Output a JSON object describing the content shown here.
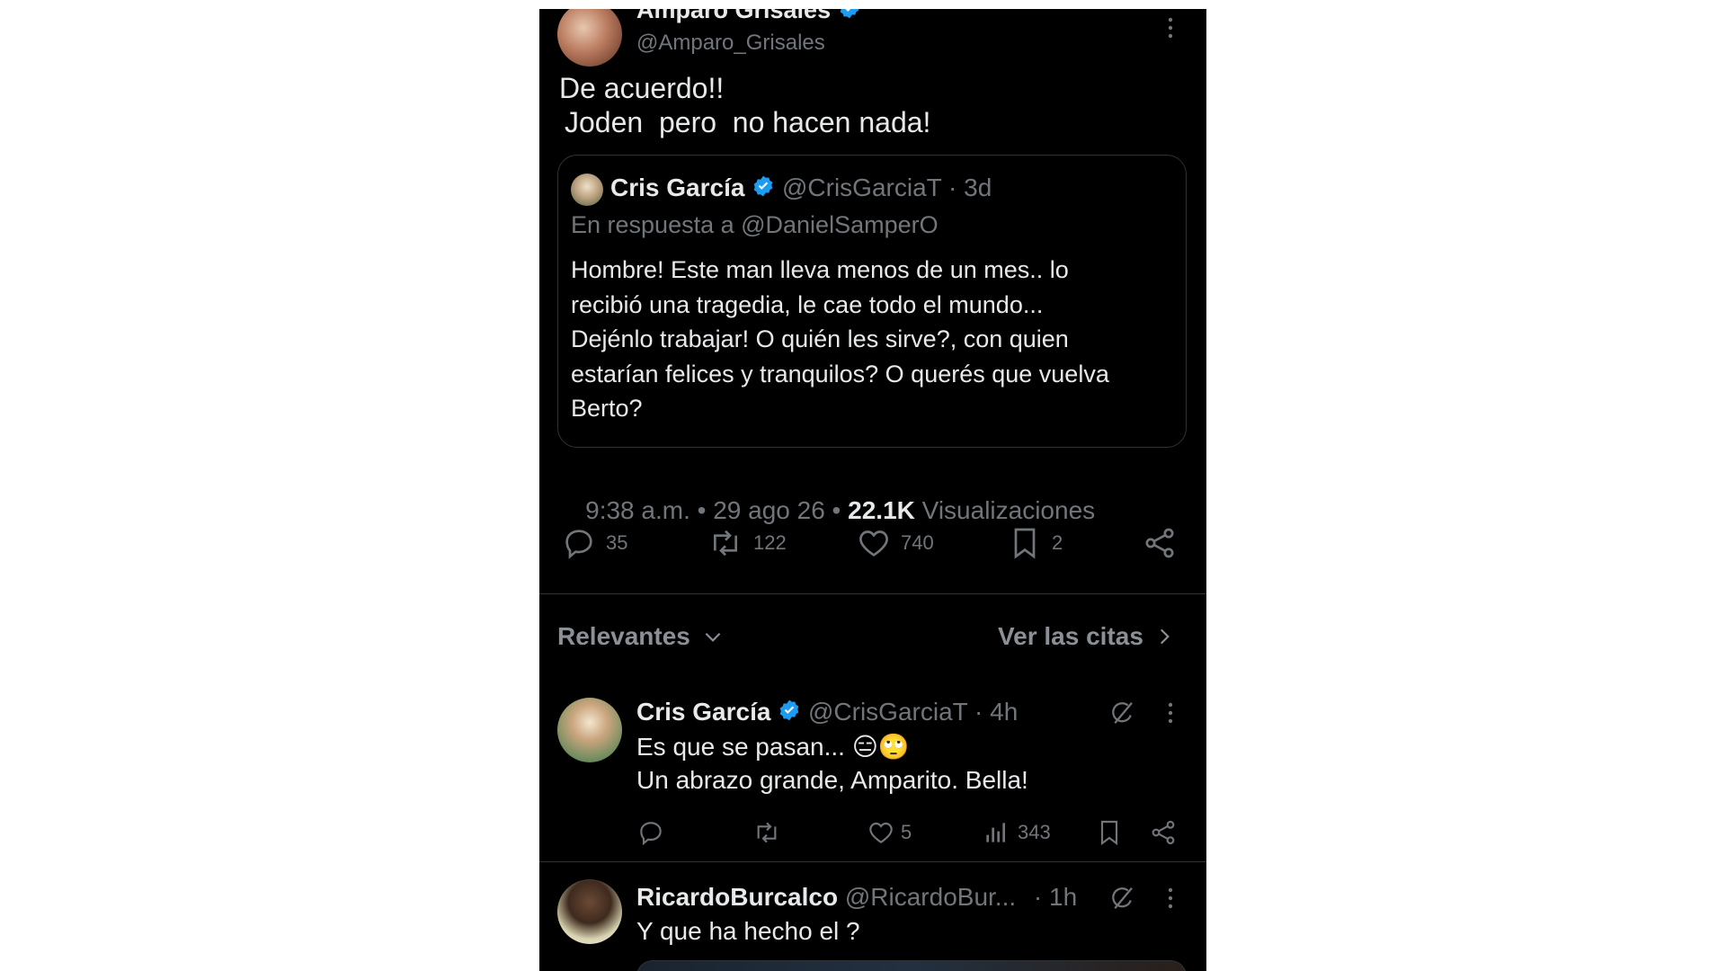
{
  "main_tweet": {
    "display_name": "Amparo Grisales",
    "handle": "@Amparo_Grisales",
    "text_line1": "De acuerdo!!",
    "text_line2": "Joden  pero  no hacen nada!",
    "meta_time": "9:38 a.m. • 29 ago 26 • ",
    "meta_views_count": "22.1K",
    "meta_views_label": " Visualizaciones",
    "actions": {
      "replies": "35",
      "retweets": "122",
      "likes": "740",
      "bookmarks": "2"
    }
  },
  "quoted_tweet": {
    "display_name": "Cris García",
    "handle": "@CrisGarciaT",
    "time": "· 3d",
    "reply_to": "En respuesta a @DanielSamperO",
    "text": [
      "Hombre! Este man lleva menos de un mes.. lo",
      "recibió una tragedia, le cae todo el mundo...",
      "Dejénlo trabajar! O quién les sirve?, con quien",
      "estarían felices y tranquilos? O querés que vuelva",
      "Berto?"
    ]
  },
  "sort_bar": {
    "sort_label": "Relevantes",
    "quotes_link": "Ver las citas"
  },
  "replies": [
    {
      "display_name": "Cris García",
      "handle": "@CrisGarciaT",
      "time": "· 4h",
      "text_line1": "Es que se pasan... 😑🙄",
      "text_line2": "Un abrazo grande, Amparito. Bella!",
      "likes": "5",
      "views": "343"
    },
    {
      "display_name": "RicardoBurcalco",
      "handle": "@RicardoBur...",
      "time": "· 1h",
      "text_line1": "Y que ha hecho el ?"
    }
  ],
  "colors": {
    "background": "#000000",
    "text": "#e7e9ea",
    "secondary": "#71767b",
    "verified": "#1d9bf0",
    "divider": "#2f3336"
  }
}
